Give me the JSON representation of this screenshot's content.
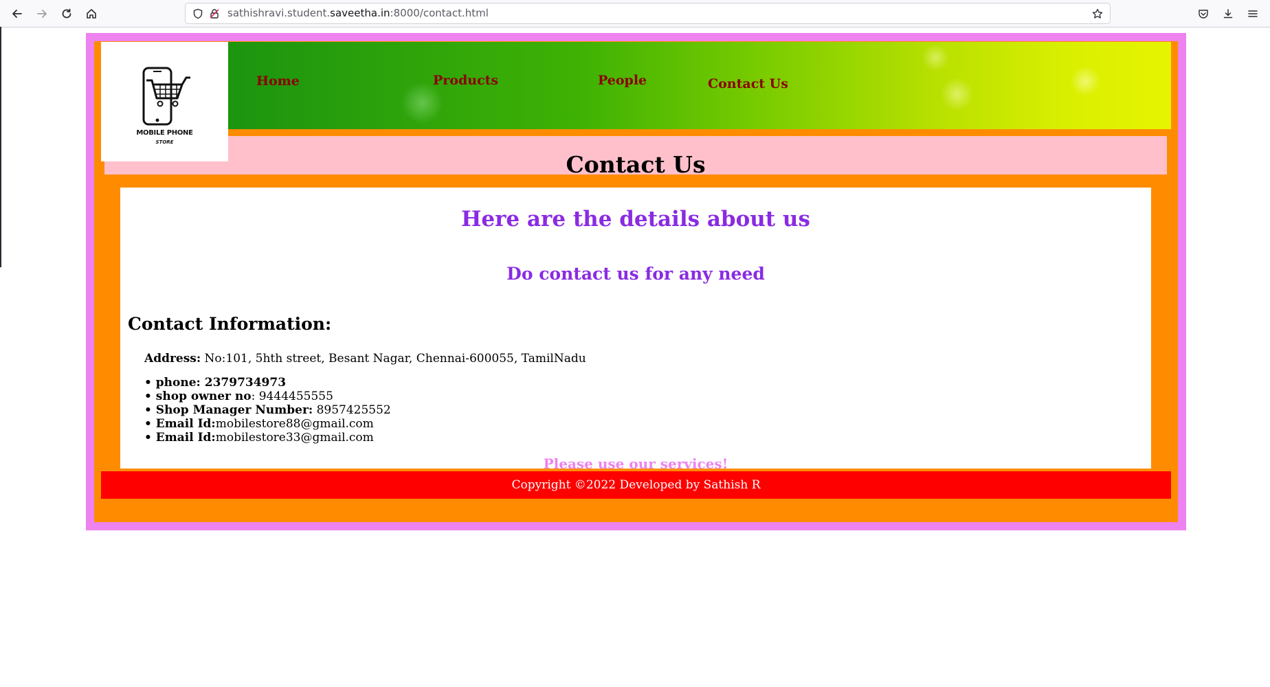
{
  "browser": {
    "url_prefix": "sathishravi.student.",
    "url_host": "saveetha.in",
    "url_suffix": ":8000/contact.html",
    "nav_icons": [
      "back-icon",
      "forward-icon",
      "reload-icon",
      "home-icon"
    ],
    "toolbar_icons": [
      "pocket-icon",
      "download-icon",
      "menu-icon"
    ]
  },
  "logo": {
    "line1": "MOBILE PHONE",
    "line2": "STORE"
  },
  "nav": {
    "home": "Home",
    "products": "Products",
    "people": "People",
    "contact": "Contact Us"
  },
  "page": {
    "title": "Contact Us",
    "heading": "Here are the details about us",
    "subheading": "Do contact us for any need",
    "info_heading": "Contact Information:",
    "address_label": "Address:",
    "address_value": " No:101, 5hth street, Besant Nagar, Chennai-600055, TamilNadu",
    "contacts": [
      {
        "label": "phone: 2379734973",
        "value": ""
      },
      {
        "label": "shop owner no",
        "value": ": 9444455555"
      },
      {
        "label": "Shop Manager Number:",
        "value": " 8957425552"
      },
      {
        "label": "Email Id:",
        "value": "mobilestore88@gmail.com"
      },
      {
        "label": "Email Id:",
        "value": "mobilestore33@gmail.com"
      }
    ],
    "closing": "Please use our services!",
    "footer": "Copyright ©2022 Developed by Sathish R"
  },
  "colors": {
    "outer_border": "#ee82ee",
    "page_bg": "#ff8c00",
    "title_band": "#ffc0cb",
    "nav_link": "#8b0000",
    "heading": "#8a2be2",
    "footer_bg": "#ff0000"
  }
}
